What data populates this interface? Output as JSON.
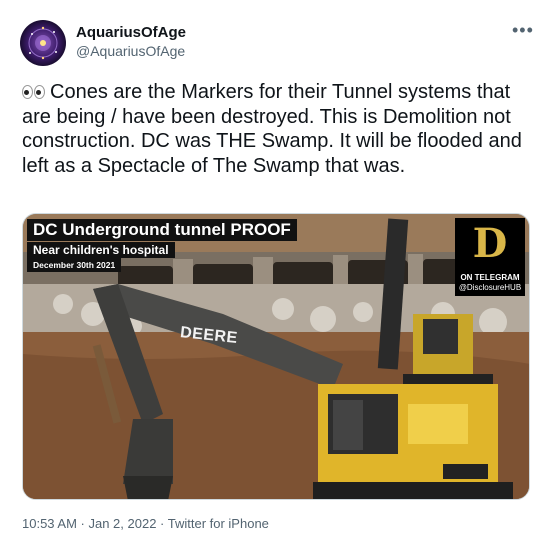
{
  "author": {
    "name": "AquariusOfAge",
    "handle": "@AquariusOfAge"
  },
  "more_icon": "more-horizontal-icon",
  "tweet": {
    "emoji": "eyes-emoji",
    "text": "Cones are the Markers for their Tunnel systems that are being / have been destroyed. This is Demolition not construction. DC was THE Swamp. It will be flooded and left as a Spectacle of The Swamp that was."
  },
  "media": {
    "title": "DC Underground tunnel  PROOF",
    "subtitle": "Near children's hospital",
    "date": "December 30th 2021",
    "logo_letter": "D",
    "logo_line1": "ON TELEGRAM",
    "logo_line2": "@DisclosureHUB",
    "machine_brand": "DEERE"
  },
  "footer": {
    "meta": "10:53 AM · Jan 2, 2022 · Twitter for iPhone"
  }
}
